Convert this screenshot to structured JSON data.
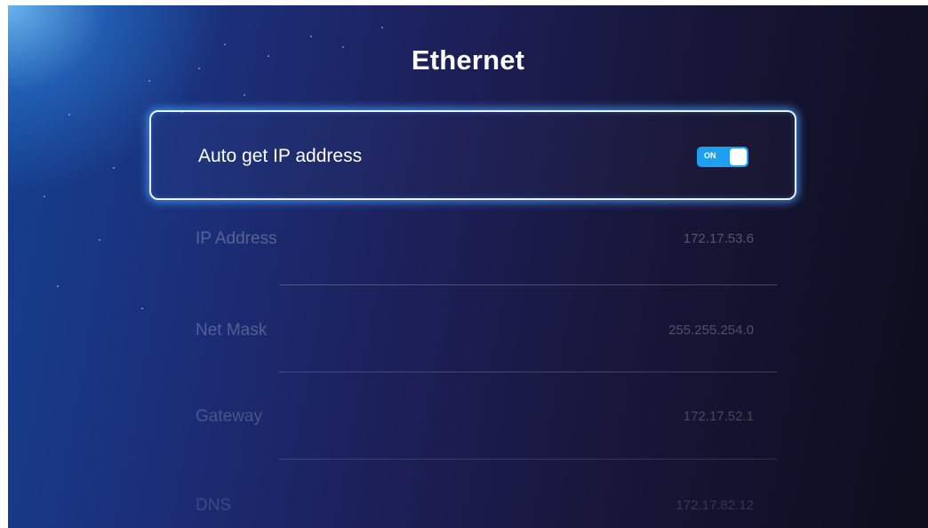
{
  "title": "Ethernet",
  "auto_ip": {
    "label": "Auto get IP address",
    "toggle_text": "ON",
    "enabled": true,
    "accent_color": "#1ea0f0"
  },
  "fields": [
    {
      "label": "IP Address",
      "value": "172.17.53.6"
    },
    {
      "label": "Net Mask",
      "value": "255.255.254.0"
    },
    {
      "label": "Gateway",
      "value": "172.17.52.1"
    },
    {
      "label": "DNS",
      "value": "172.17.82.12"
    }
  ]
}
